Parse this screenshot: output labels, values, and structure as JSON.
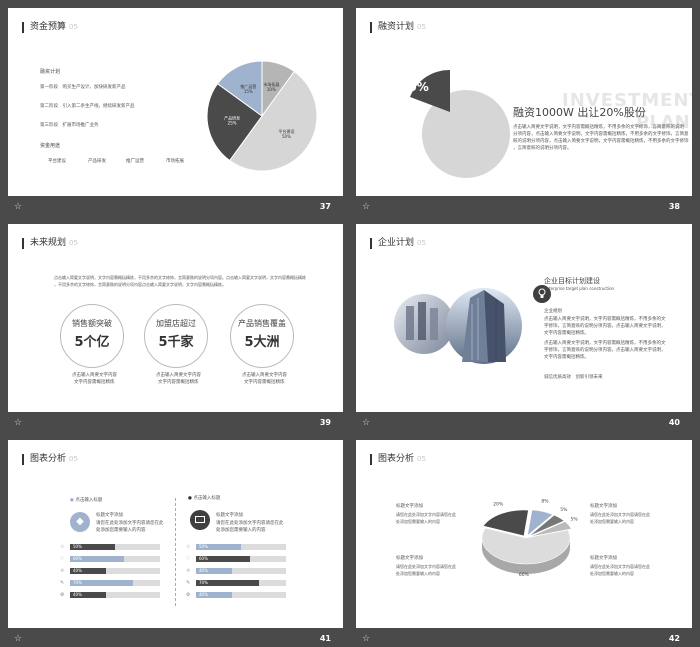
{
  "slides": [
    {
      "title": "资金预算",
      "sub": "05",
      "number": "37",
      "plan_title": "融资计划",
      "stages": [
        {
          "label": "第一阶段",
          "text": "购买生产设计，加快研发新产品"
        },
        {
          "label": "第二阶段",
          "text": "引入第二条生产线，继续研发新产品"
        },
        {
          "label": "第三阶段",
          "text": "扩展市场推广业务"
        }
      ],
      "use_title": "资金用途",
      "uses": [
        "平台建设",
        "产品研发",
        "推广运营",
        "市场拓展"
      ],
      "chart_data": {
        "type": "pie",
        "slices": [
          {
            "label": "平台建设",
            "value": 50,
            "pct_label": "50%",
            "color": "#d6d6d6"
          },
          {
            "label": "产品研发",
            "value": 25,
            "pct_label": "25%",
            "color": "#4a4a4a"
          },
          {
            "label": "推广运营",
            "value": 15,
            "pct_label": "15%",
            "color": "#9fb3cf"
          },
          {
            "label": "市场拓展",
            "value": 10,
            "pct_label": "10%",
            "color": "#b5b5b5"
          }
        ]
      }
    },
    {
      "title": "融资计划",
      "sub": "05",
      "number": "38",
      "percent": "20%",
      "headline": "融资1000W 出让20%股份",
      "watermark1": "INVESTMENT",
      "watermark2": "PLAN",
      "body": [
        "点击输入简要文字说明，文字内容需概括精炼，不用多余的文字修饰，言简意赅的说明",
        "分项内容，点击输入简要文字说明，文字内容需概括精炼，不用多余的文字修饰，言简意",
        "赅的说明分项内容，点击输入简要文字说明，文字内容需概括精炼，不用多余的文字修饰",
        "，言简意赅的说明分项内容。"
      ]
    },
    {
      "title": "未来规划",
      "sub": "05",
      "number": "39",
      "intro": [
        "点击输入简要文字说明，文字内容需概括精炼，不用多余的文字修饰，言简意赅的说明分项内容。点击输入简要文字说明，文字内容需概括精炼",
        "，不用多余的文字修饰，言简意赅的说明分项内容点击输入简要文字说明，文字内容需概括精炼。"
      ],
      "goals": [
        {
          "line1": "销售额突破",
          "line2": "5个亿",
          "desc1": "点击输入简要文字内容",
          "desc2": "文字内容需概括精炼"
        },
        {
          "line1": "加盟店超过",
          "line2": "5千家",
          "desc1": "点击输入简要文字内容",
          "desc2": "文字内容需概括精炼"
        },
        {
          "line1": "产品销售覆盖",
          "line2": "5大洲",
          "desc1": "点击输入简要文字内容",
          "desc2": "文字内容需概括精炼"
        }
      ]
    },
    {
      "title": "企业计划",
      "sub": "05",
      "number": "40",
      "heading": "企业目标计划建设",
      "heading_en": "Enterprise target plan construction",
      "item_title": "企业规划",
      "paragraphs": [
        [
          "点击输入简要文字说明，文字内容需概括精炼，不用多余的文",
          "字修饰，言简意赅的说明分项内容。点击输入简要文字说明，",
          "文字内容需概括精炼。"
        ],
        [
          "点击输入简要文字说明，文字内容需概括精炼，不用多余的文",
          "字修饰，言简意赅的说明分项内容。点击输入简要文字说明，",
          "文字内容需概括精炼。"
        ]
      ],
      "slogan": "诚信优质高效　创新引领未来"
    },
    {
      "title": "图表分析",
      "sub": "05",
      "number": "41",
      "left_header": "点击输入标题",
      "right_header": "点击输入标题",
      "left_title": "标题文字添加",
      "left_desc": [
        "请您在此处添加文字内容请您在此",
        "处添加您需要输入的内容"
      ],
      "right_title": "标题文字添加",
      "right_desc": [
        "请您在此处添加文字内容请您在此",
        "处添加您需要输入的内容"
      ],
      "left_bars": [
        {
          "label": "50%",
          "value": 50,
          "color": "#4a4a4a"
        },
        {
          "label": "60%",
          "value": 60,
          "color": "#9fb3cf"
        },
        {
          "label": "40%",
          "value": 40,
          "color": "#4a4a4a"
        },
        {
          "label": "70%",
          "value": 70,
          "color": "#9fb3cf"
        },
        {
          "label": "40%",
          "value": 40,
          "color": "#4a4a4a"
        }
      ],
      "right_bars": [
        {
          "label": "50%",
          "value": 50,
          "color": "#9fb3cf"
        },
        {
          "label": "60%",
          "value": 60,
          "color": "#4a4a4a"
        },
        {
          "label": "40%",
          "value": 40,
          "color": "#9fb3cf"
        },
        {
          "label": "70%",
          "value": 70,
          "color": "#4a4a4a"
        },
        {
          "label": "40%",
          "value": 40,
          "color": "#9fb3cf"
        }
      ]
    },
    {
      "title": "图表分析",
      "sub": "05",
      "number": "42",
      "callouts": [
        {
          "title": "标题文字添加",
          "desc": [
            "请您在此处添加文字内容请您在此",
            "处添加您需要输入的内容"
          ]
        },
        {
          "title": "标题文字添加",
          "desc": [
            "请您在此处添加文字内容请您在此",
            "处添加您需要输入的内容"
          ]
        },
        {
          "title": "标题文字添加",
          "desc": [
            "请您在此处添加文字内容请您在此",
            "处添加您需要输入的内容"
          ]
        },
        {
          "title": "标题文字添加",
          "desc": [
            "请您在此处添加文字内容请您在此",
            "处添加您需要输入的内容"
          ]
        }
      ],
      "chart_data": {
        "type": "pie",
        "slices": [
          {
            "label": "60%",
            "value": 60,
            "color": "#dcdcdc"
          },
          {
            "label": "20%",
            "value": 20,
            "color": "#4a4a4a"
          },
          {
            "label": "8%",
            "value": 8,
            "color": "#9fb3cf"
          },
          {
            "label": "5%",
            "value": 5,
            "color": "#777777"
          },
          {
            "label": "5%",
            "value": 5,
            "color": "#bbbbbb"
          }
        ]
      }
    }
  ]
}
